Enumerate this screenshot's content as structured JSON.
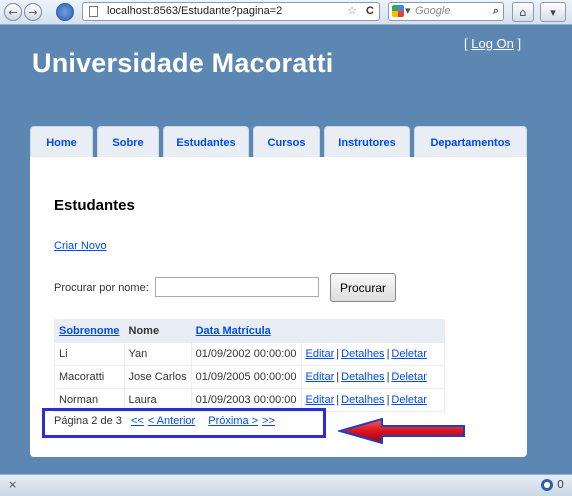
{
  "browser": {
    "back_icon": "←",
    "forward_icon": "→",
    "url": "localhost:8563/Estudante?pagina=2",
    "star_icon": "☆",
    "reload_icon": "C",
    "search_placeholder": "Google",
    "search_icon": "⌕",
    "home_icon": "⌂",
    "menu_icon": "▾"
  },
  "header": {
    "login_open": "[",
    "login_label": "Log On",
    "login_close": "]",
    "title": "Universidade Macoratti"
  },
  "tabs": [
    "Home",
    "Sobre",
    "Estudantes",
    "Cursos",
    "Instrutores",
    "Departamentos"
  ],
  "main": {
    "heading": "Estudantes",
    "create_link": "Criar Novo",
    "search_label": "Procurar por nome:",
    "search_value": "",
    "search_button": "Procurar"
  },
  "table": {
    "headers": [
      "Sobrenome",
      "Nome",
      "Data Matrícula",
      ""
    ],
    "rows": [
      {
        "sobrenome": "Li",
        "nome": "Yan",
        "data": "01/09/2002 00:00:00"
      },
      {
        "sobrenome": "Macoratti",
        "nome": "Jose Carlos",
        "data": "01/09/2005 00:00:00"
      },
      {
        "sobrenome": "Norman",
        "nome": "Laura",
        "data": "01/09/2003 00:00:00"
      }
    ],
    "action_edit": "Editar",
    "action_details": "Detalhes",
    "action_delete": "Deletar",
    "separator": "|"
  },
  "pager": {
    "text": "Página 2 de 3",
    "first": "<<",
    "previous": "< Anterior",
    "next": "Próxima >",
    "last": ">>"
  },
  "statusbar": {
    "close": "×",
    "addon_count": "0"
  },
  "colors": {
    "page_bg": "#5c87b2",
    "link": "#034af3",
    "highlight_box": "#2b2bd9",
    "arrow": "#e0202a"
  }
}
